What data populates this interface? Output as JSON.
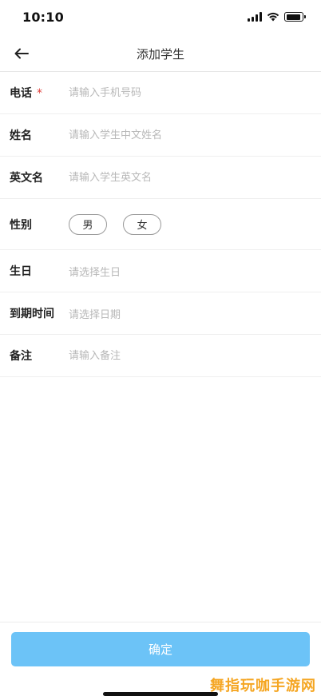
{
  "status_bar": {
    "time": "10:10",
    "icons": [
      "signal-icon",
      "wifi-icon",
      "battery-icon"
    ]
  },
  "nav": {
    "back_icon": "arrow-left-icon",
    "title": "添加学生"
  },
  "form": {
    "phone": {
      "label": "电话",
      "required_mark": "*",
      "placeholder": "请输入手机号码"
    },
    "name": {
      "label": "姓名",
      "placeholder": "请输入学生中文姓名"
    },
    "english_name": {
      "label": "英文名",
      "placeholder": "请输入学生英文名"
    },
    "gender": {
      "label": "性别",
      "options": [
        "男",
        "女"
      ]
    },
    "birthday": {
      "label": "生日",
      "placeholder": "请选择生日"
    },
    "expiry": {
      "label": "到期时间",
      "placeholder": "请选择日期"
    },
    "note": {
      "label": "备注",
      "placeholder": "请输入备注"
    }
  },
  "footer": {
    "confirm_label": "确定"
  },
  "watermark": "舞指玩咖手游网",
  "colors": {
    "primary_button": "#6cc3f7",
    "required": "#e0413c",
    "placeholder": "#b8b8b8",
    "watermark": "#f5a623"
  }
}
